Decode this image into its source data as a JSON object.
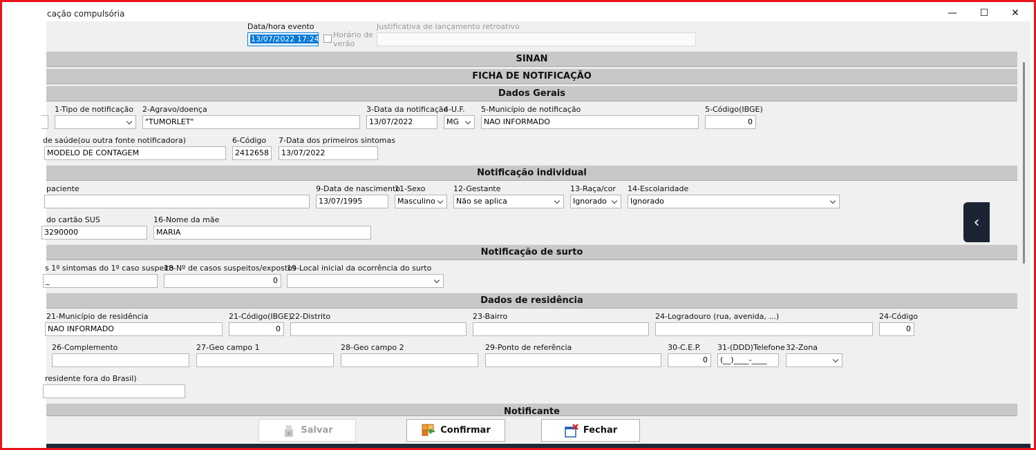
{
  "window": {
    "title": "cação compulsória",
    "minimize": "—",
    "maximize": "☐",
    "close": "✕"
  },
  "top": {
    "datetime_label": "Data/hora evento",
    "datetime_value": "13/07/2022 17:24",
    "dst_label_1": "Horário de",
    "dst_label_2": "verão",
    "justificativa_label": "Justificativa de lançamento retroativo",
    "justificativa_value": ""
  },
  "sections": {
    "sinan": "SINAN",
    "ficha": "FICHA DE NOTIFICAÇÃO",
    "dados_gerais": "Dados Gerais",
    "notificacao_individual": "Notificação individual",
    "notificacao_surto": "Notificação de surto",
    "dados_residencia": "Dados de residência",
    "notificante": "Notificante"
  },
  "dados_gerais": {
    "tipo_label": "1-Tipo de notificação",
    "tipo_value": "",
    "agravo_label": "2-Agravo/doença",
    "agravo_value": "\"TUMORLET\"",
    "data_notif_label": "3-Data da notificação",
    "data_notif_value": "13/07/2022",
    "uf_label": "4-U.F.",
    "uf_value": "MG",
    "municipio_label": "5-Município de notificação",
    "municipio_value": "NAO INFORMADO",
    "codigo_ibge_label": "5-Código(IBGE)",
    "codigo_ibge_value": "0",
    "unidade_label": "de saúde(ou outra fonte notificadora)",
    "unidade_value": "MODELO DE CONTAGEM",
    "codigo_label": "6-Código",
    "codigo_value": "2412658",
    "data_sintomas_label": "7-Data dos primeiros sintomas",
    "data_sintomas_value": "13/07/2022"
  },
  "individual": {
    "paciente_label": "paciente",
    "paciente_value": "",
    "nascimento_label": "9-Data de nascimento",
    "nascimento_value": "13/07/1995",
    "sexo_label": "11-Sexo",
    "sexo_value": "Masculino",
    "gestante_label": "12-Gestante",
    "gestante_value": "Não se aplica",
    "raca_label": "13-Raça/cor",
    "raca_value": "Ignorado",
    "escolaridade_label": "14-Escolaridade",
    "escolaridade_value": "Ignorado",
    "cartao_label": "do cartão SUS",
    "cartao_value": "3290000",
    "mae_label": "16-Nome da mãe",
    "mae_value": "MARIA"
  },
  "surto": {
    "sintomas_label": "s 1º sintomas do 1º caso suspeito",
    "sintomas_value": "_",
    "casos_label": "18-Nº de casos suspeitos/expostos",
    "casos_value": "0",
    "local_label": "19-Local inicial da ocorrência do surto",
    "local_value": ""
  },
  "residencia": {
    "municipio_label": "21-Município de residência",
    "municipio_value": "NAO INFORMADO",
    "codigo_ibge_label": "21-Código(IBGE)",
    "codigo_ibge_value": "0",
    "distrito_label": "22-Distrito",
    "distrito_value": "",
    "bairro_label": "23-Bairro",
    "bairro_value": "",
    "logradouro_label": "24-Logradouro (rua, avenida, ...)",
    "logradouro_value": "",
    "codigo24_label": "24-Código",
    "codigo24_value": "0",
    "complemento_label": "26-Complemento",
    "complemento_value": "",
    "geo1_label": "27-Geo campo 1",
    "geo1_value": "",
    "geo2_label": "28-Geo campo 2",
    "geo2_value": "",
    "referencia_label": "29-Ponto de referência",
    "referencia_value": "",
    "cep_label": "30-C.E.P.",
    "cep_value": "0",
    "telefone_label": "31-(DDD)Telefone",
    "telefone_value": "(__)____-____",
    "zona_label": "32-Zona",
    "zona_value": "",
    "exterior_label": "residente fora do Brasil)",
    "exterior_value": ""
  },
  "buttons": {
    "salvar": "Salvar",
    "confirmar": "Confirmar",
    "fechar": "Fechar"
  },
  "side_tab": {
    "icon": "chevron-left-icon",
    "glyph": "‹"
  },
  "colors": {
    "frame": "#e8141c",
    "section": "#c8c8c8",
    "selection": "#0078d7"
  }
}
